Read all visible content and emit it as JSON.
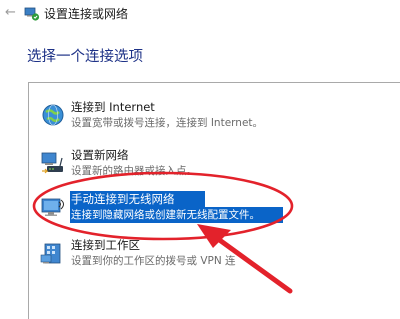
{
  "window": {
    "title": "设置连接或网络",
    "back_icon": "back-arrow-icon",
    "title_icon": "network-setup-icon"
  },
  "main": {
    "heading": "选择一个连接选项"
  },
  "options": [
    {
      "title": "连接到 Internet",
      "description": "设置宽带或拨号连接，连接到 Internet。",
      "icon": "globe-icon",
      "selected": false
    },
    {
      "title": "设置新网络",
      "description": "设置新的路由器或接入点。",
      "icon": "router-icon",
      "selected": false
    },
    {
      "title": "手动连接到无线网络",
      "description": "连接到隐藏网络或创建新无线配置文件。",
      "icon": "wireless-monitor-icon",
      "selected": true
    },
    {
      "title": "连接到工作区",
      "description": "设置到你的工作区的拨号或 VPN 连",
      "icon": "workplace-icon",
      "selected": false
    }
  ],
  "annotation": {
    "ellipse_color": "#e3222b",
    "arrow_color": "#e3222b"
  },
  "colors": {
    "selection": "#0a64c8",
    "heading": "#1e3287"
  }
}
